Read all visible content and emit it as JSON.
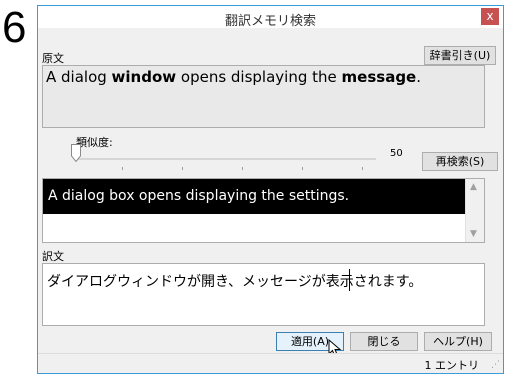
{
  "step_number": "6",
  "window": {
    "title": "翻訳メモリ検索",
    "close_label": "x"
  },
  "source": {
    "label": "原文",
    "dict_button": "辞書引き(U)",
    "text_parts": [
      {
        "text": "A dialog ",
        "bold": false
      },
      {
        "text": "window",
        "bold": true
      },
      {
        "text": " opens displaying the ",
        "bold": false
      },
      {
        "text": "message",
        "bold": true
      },
      {
        "text": ".",
        "bold": false
      }
    ]
  },
  "similarity": {
    "label": "類似度:",
    "value": "50",
    "level": 0
  },
  "research_button": "再検索(S)",
  "result": {
    "selected_text": "A dialog box opens displaying the settings."
  },
  "target": {
    "label": "訳文",
    "text": "ダイアログウィンドウが開き、メッセージが表示されます。"
  },
  "buttons": {
    "apply": "適用(A)",
    "close": "閉じる",
    "help": "ヘルプ(H)"
  },
  "status": {
    "entries": "1 エントリ"
  },
  "colors": {
    "selection_bg": "#000000",
    "close_bg": "#c75050",
    "window_border": "#3c9cd7"
  }
}
